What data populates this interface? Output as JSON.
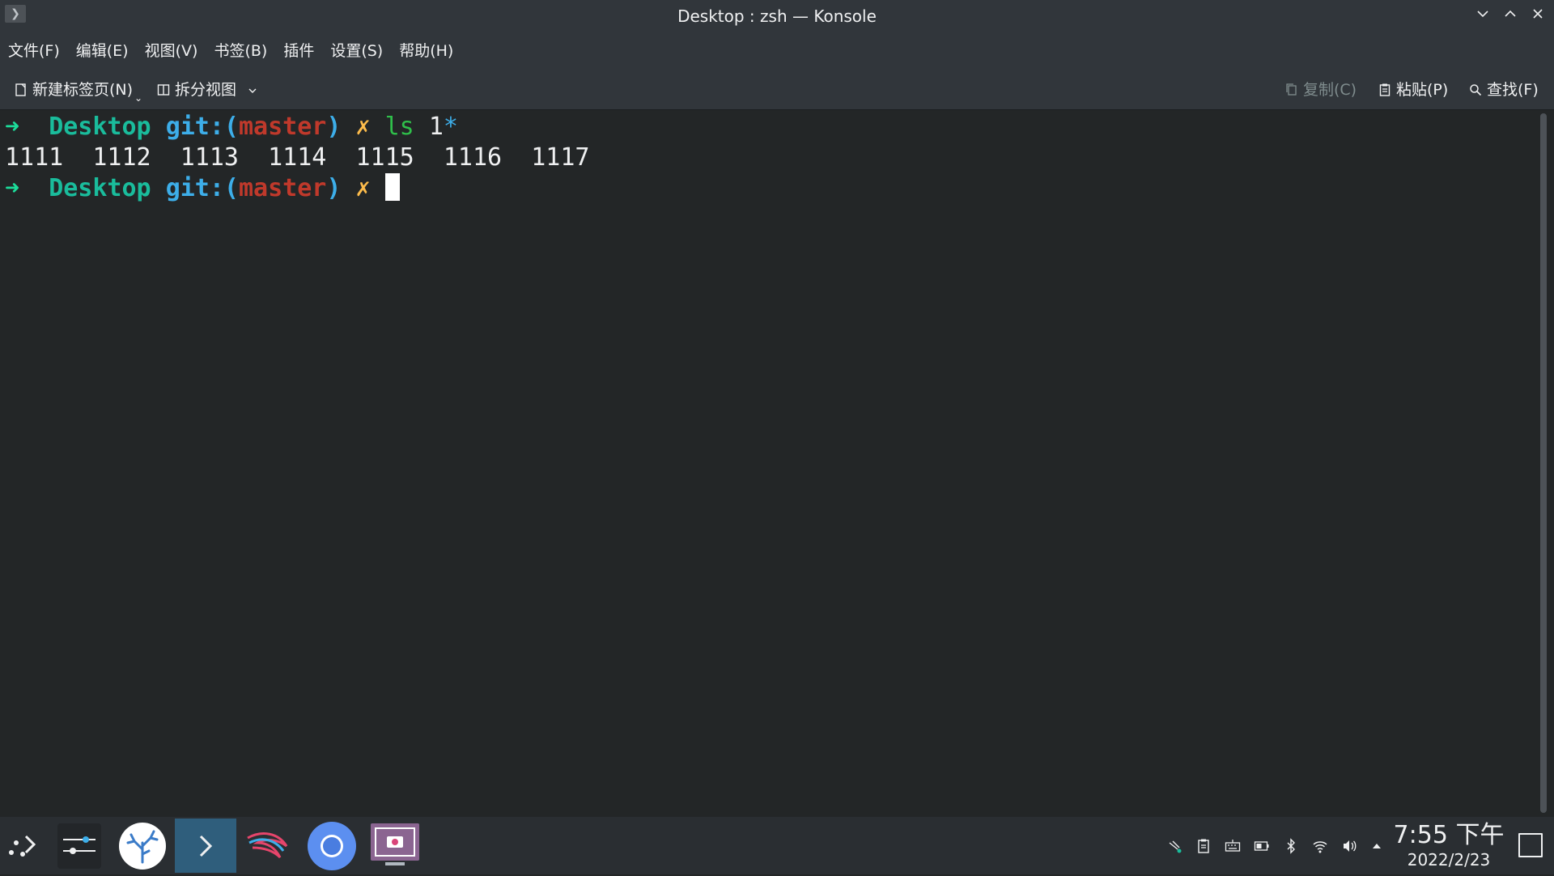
{
  "window": {
    "title": "Desktop : zsh — Konsole"
  },
  "menu": {
    "items": [
      "文件(F)",
      "编辑(E)",
      "视图(V)",
      "书签(B)",
      "插件",
      "设置(S)",
      "帮助(H)"
    ]
  },
  "toolbar": {
    "new_tab_label": "新建标签页(N)",
    "split_view_label": "拆分视图",
    "copy_label": "复制(C)",
    "paste_label": "粘贴(P)",
    "find_label": "查找(F)"
  },
  "terminal": {
    "prompt_arrow": "➜",
    "prompt_dir": "Desktop",
    "prompt_git": "git:(",
    "prompt_branch": "master",
    "prompt_git_close": ")",
    "prompt_dirty": "✗",
    "command_name": "ls",
    "command_arg": "1",
    "command_glob": "*",
    "output_line": "1111  1112  1113  1114  1115  1116  1117"
  },
  "taskbar": {
    "apps": [
      {
        "icon": "application-launcher-icon"
      },
      {
        "icon": "system-settings-icon"
      },
      {
        "icon": "coral-app-icon"
      },
      {
        "icon": "konsole-icon",
        "active": true
      },
      {
        "icon": "kali-dragon-icon"
      },
      {
        "icon": "chromium-icon"
      },
      {
        "icon": "screenshot-tool-icon"
      }
    ],
    "tray_icons": [
      "network-activity-icon",
      "clipboard-icon",
      "keyboard-icon",
      "battery-icon",
      "bluetooth-icon",
      "wifi-icon",
      "volume-icon",
      "tray-expand-icon"
    ],
    "clock_time": "7:55 下午",
    "clock_date": "2022/2/23"
  },
  "colors": {
    "background": "#232627",
    "chrome": "#31363b",
    "taskbar": "#2a2e32",
    "active_task": "#2f5e7c",
    "prompt_green": "#1cdc9a",
    "git_blue": "#3daee9",
    "branch_red": "#c0392b",
    "dirty_yellow": "#fdbc4b"
  }
}
